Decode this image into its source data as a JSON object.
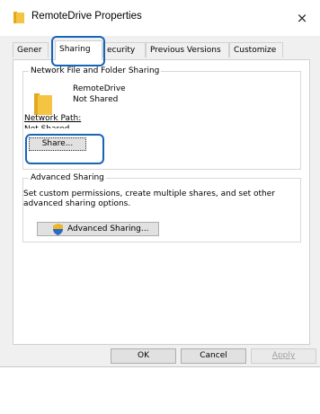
{
  "window": {
    "title": "RemoteDrive Properties",
    "close_glyph": "×",
    "title_icon": "folder-icon"
  },
  "tabs": [
    {
      "label": "Gener",
      "active": false
    },
    {
      "label": "Sharing",
      "active": true
    },
    {
      "label": "ecurity",
      "active": false
    },
    {
      "label": "Previous Versions",
      "active": false
    },
    {
      "label": "Customize",
      "active": false
    }
  ],
  "network_sharing": {
    "group_title": "Network File and Folder Sharing",
    "folder_name": "RemoteDrive",
    "share_status": "Not Shared",
    "network_path_label": "Network Path:",
    "network_path_value": "Not Shared",
    "share_button": "Share..."
  },
  "advanced_sharing": {
    "group_title": "Advanced Sharing",
    "description": "Set custom permissions, create multiple shares, and set other advanced sharing options.",
    "button_label": "Advanced Sharing...",
    "button_icon": "shield-icon"
  },
  "footer": {
    "ok": "OK",
    "cancel": "Cancel",
    "apply": "Apply"
  },
  "colors": {
    "focus_ring": "#1565b8",
    "folder": "#f6c443"
  }
}
